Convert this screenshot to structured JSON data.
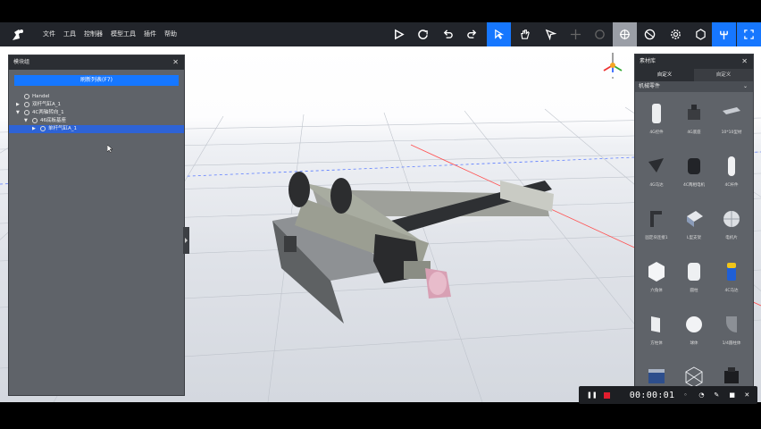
{
  "menu": [
    "文件",
    "工具",
    "控制器",
    "模型工具",
    "插件",
    "帮助"
  ],
  "toolbar_icons": [
    "play-icon",
    "reset-icon",
    "undo-icon",
    "redo-icon",
    "select-icon",
    "hand-icon",
    "cursor-icon",
    "move-icon",
    "rotate-icon",
    "orbit-icon",
    "globe-icon",
    "settings-icon",
    "cube-icon",
    "branch-icon",
    "fullscreen-icon"
  ],
  "left_panel": {
    "title": "模块组",
    "refresh_label": "刷新列表(F7)",
    "tree": [
      {
        "label": "Handel",
        "depth": 0,
        "arrow": "",
        "selected": false
      },
      {
        "label": "双杆气缸A_1",
        "depth": 0,
        "arrow": "▶",
        "selected": false
      },
      {
        "label": "4C两轴转向_1",
        "depth": 0,
        "arrow": "▼",
        "selected": false
      },
      {
        "label": "46底板基座",
        "depth": 1,
        "arrow": "▼",
        "selected": false
      },
      {
        "label": "单杆气缸A_1",
        "depth": 2,
        "arrow": "▶",
        "selected": true
      }
    ]
  },
  "right_panel": {
    "title": "素材库",
    "tabs": [
      "自定义",
      "自定义"
    ],
    "category": "机械零件",
    "items": [
      {
        "label": "4G控件",
        "shape": "cyl-white"
      },
      {
        "label": "4G底座",
        "shape": "box-dark"
      },
      {
        "label": "10*10型材",
        "shape": "bar"
      },
      {
        "label": "4G马达",
        "shape": "wedge"
      },
      {
        "label": "4C两相电机",
        "shape": "cyl-dark"
      },
      {
        "label": "4C杆件",
        "shape": "tube"
      },
      {
        "label": "固定块连接1",
        "shape": "bracket"
      },
      {
        "label": "L型支架",
        "shape": "block-blue"
      },
      {
        "label": "电机片",
        "shape": "fan"
      },
      {
        "label": "六角体",
        "shape": "hex"
      },
      {
        "label": "圆柱",
        "shape": "cylinder"
      },
      {
        "label": "4C马达",
        "shape": "battery"
      },
      {
        "label": "方柱体",
        "shape": "prism"
      },
      {
        "label": "球体",
        "shape": "sphere"
      },
      {
        "label": "1/4圆柱体",
        "shape": "quarter"
      },
      {
        "label": "",
        "shape": "cart"
      },
      {
        "label": "",
        "shape": "wire"
      },
      {
        "label": "",
        "shape": "dark-block"
      }
    ]
  },
  "recorder": {
    "time": "00:00:01"
  },
  "colors": {
    "accent": "#1677ff",
    "record": "#e11d2e"
  }
}
